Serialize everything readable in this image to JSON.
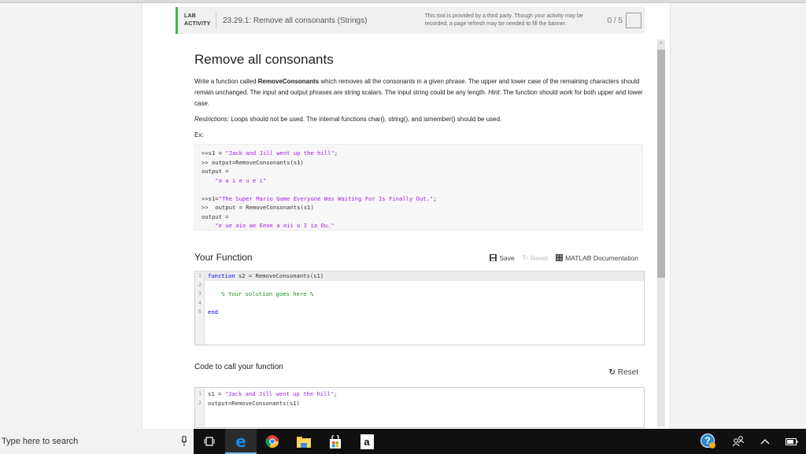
{
  "banner": {
    "lab_label": "LAB ACTIVITY",
    "lab_line1": "LAB",
    "lab_line2": "ACTIVITY",
    "title": "23.29.1: Remove all consonants (Strings)",
    "note": "This tool is provided by a third party. Though your activity may be recorded, a page refresh may be needed to fill the banner.",
    "score": "0 / 5",
    "accent_color": "#4caf50"
  },
  "problem": {
    "heading": "Remove all consonants",
    "desc_pre": "Write a function called ",
    "desc_bold": "RemoveConsonants",
    "desc_post": " which removes all the consonants in a given phrase.  The upper and lower case of the remaining characters should remain unchanged. The input and output phrases are string scalars. The input string could be any length.  ",
    "hint_label": "Hint:",
    "hint_text": " The function should work for both upper and lower case.",
    "restrictions_label": "Restrictions:",
    "restrictions_text": "  Loops should not be used.  The internal functions char(), string(), and ismember() should be used.",
    "ex_label": "Ex:",
    "example": {
      "l1_pre": ">>s1 = ",
      "l1_str": "\"Jack and Jill went up the hill\"",
      "l1_post": ";",
      "l2": ">> output=RemoveConsonants(s1)",
      "l3": "output =",
      "l4": "    \"a a i e u e i\"",
      "l5_pre": ">>s1=",
      "l5_str": "\"The Super Mario Game Everyone Was Waiting For Is Finally Out.\"",
      "l5_post": ";",
      "l6": ">>  output = RemoveConsonants(s1)",
      "l7": "output =",
      "l8": "    \"e ue aio ae Eeoe a aii o I ia Ou.\""
    }
  },
  "your_function": {
    "title": "Your Function",
    "save_label": "Save",
    "reset_label": "Reset",
    "docs_label": "MATLAB Documentation",
    "lines": [
      {
        "num": "1",
        "kw": "function",
        "code": " s2 = RemoveConsonants(s1)"
      },
      {
        "num": "2",
        "code": ""
      },
      {
        "num": "3",
        "comment": "    % Your solution goes here %"
      },
      {
        "num": "4",
        "code": ""
      },
      {
        "num": "5",
        "kw": "end",
        "code": ""
      }
    ]
  },
  "call_code": {
    "title": "Code to call your function",
    "reset_label": "Reset",
    "lines": [
      {
        "num": "1",
        "pre": "s1 = ",
        "str": "\"Jack and Jill went up the hill\"",
        "post": ";"
      },
      {
        "num": "2",
        "pre": "output=RemoveConsonants(s1)"
      }
    ]
  },
  "taskbar": {
    "search_placeholder": "Type here to search",
    "apps": [
      "task-view",
      "edge",
      "chrome",
      "file-explorer",
      "store",
      "amazon"
    ]
  }
}
